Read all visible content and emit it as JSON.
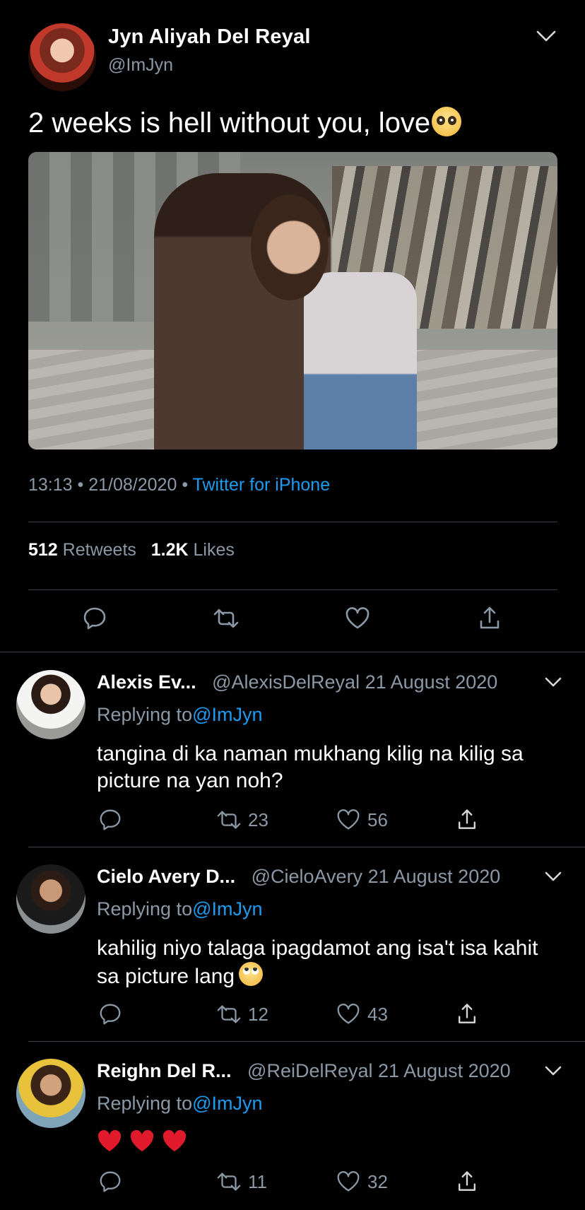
{
  "main_tweet": {
    "author_name": "Jyn Aliyah Del Reyal",
    "author_handle": "@ImJyn",
    "text": "2 weeks is hell without you, love",
    "text_emoji": "pleading-face-emoji",
    "time": "13:13",
    "date": "21/08/2020",
    "source": "Twitter for iPhone",
    "separator": "•",
    "retweets_count": "512",
    "retweets_label": "Retweets",
    "likes_count": "1.2K",
    "likes_label": "Likes",
    "icons": [
      "reply-icon",
      "retweet-icon",
      "like-icon",
      "share-icon",
      "chevron-down-icon"
    ]
  },
  "replies": [
    {
      "name": "Alexis Ev...",
      "handle": "@AlexisDelReyal",
      "date": "21 August 2020",
      "replying_label": "Replying to",
      "replying_to": "@ImJyn",
      "text": "tangina di ka naman mukhang kilig na kilig sa picture na yan noh?",
      "retweets": "23",
      "likes": "56"
    },
    {
      "name": "Cielo Avery D...",
      "handle": "@CieloAvery",
      "date": "21 August 2020",
      "replying_label": "Replying to",
      "replying_to": "@ImJyn",
      "text": "kahilig niyo talaga ipagdamot ang isa't isa kahit sa picture lang",
      "text_emoji": "face-with-rolling-eyes-emoji",
      "retweets": "12",
      "likes": "43"
    },
    {
      "name": "Reighn Del R...",
      "handle": "@ReiDelReyal",
      "date": "21 August 2020",
      "replying_label": "Replying to",
      "replying_to": "@ImJyn",
      "text": "",
      "text_emoji": "red-heart-emoji x3",
      "retweets": "11",
      "likes": "32"
    }
  ],
  "colors": {
    "background": "#000000",
    "text": "#ffffff",
    "secondary": "#8b98a5",
    "link": "#1d9bf0",
    "divider": "#38444d"
  }
}
